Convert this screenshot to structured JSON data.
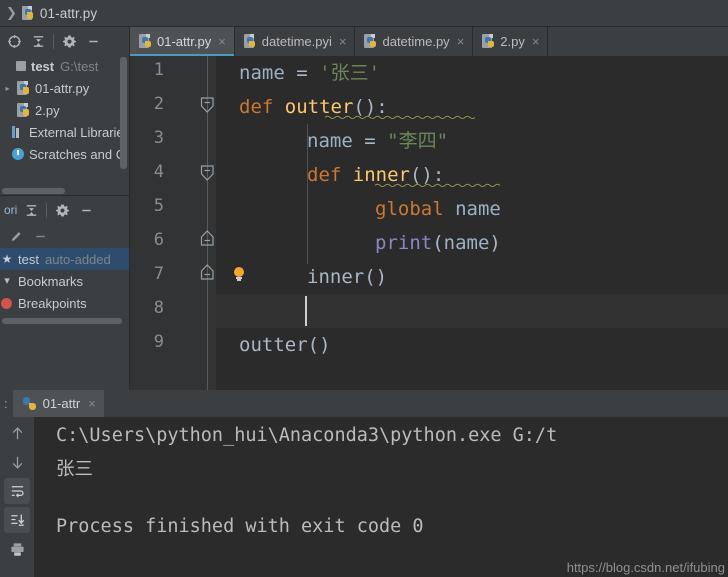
{
  "window": {
    "breadcrumb": {
      "chevron": "❯",
      "file": "01-attr.py",
      "icon": "python-file-icon"
    }
  },
  "colors": {
    "accent": "#4a9ac4",
    "panel_bg": "#3c3f41",
    "editor_bg": "#2b2b2b",
    "gutter_bg": "#313335",
    "selection": "#2d4c6e",
    "keyword": "#cc7832",
    "string": "#6a8759",
    "function": "#ffc66d",
    "builtin": "#8888c6",
    "identifier": "#9eb0c4",
    "line_number": "#8c8c8c",
    "bulb": "#f0a732"
  },
  "project_panel": {
    "toolbar": [
      {
        "name": "locate-target-icon",
        "title": "Select Opened File"
      },
      {
        "name": "collapse-all-icon",
        "title": "Collapse All"
      },
      {
        "name": "gear-icon",
        "title": "Settings"
      },
      {
        "name": "minimize-icon",
        "title": "Hide"
      }
    ],
    "tree": [
      {
        "label": "test",
        "sub": "G:\\test",
        "icon": "module-icon",
        "arrow": "",
        "bold": true,
        "selected": false
      },
      {
        "label": "01-attr.py",
        "sub": "",
        "icon": "python-file-icon",
        "arrow": "▸",
        "bold": false,
        "selected": false
      },
      {
        "label": "2.py",
        "sub": "",
        "icon": "python-file-icon",
        "arrow": "",
        "bold": false,
        "selected": false
      },
      {
        "label": "External Librarie",
        "sub": "",
        "icon": "library-icon",
        "arrow": "",
        "bold": false,
        "selected": false
      },
      {
        "label": "Scratches and C",
        "sub": "",
        "icon": "scratches-icon",
        "arrow": "",
        "bold": false,
        "selected": false
      }
    ]
  },
  "favorites_panel": {
    "title": "ori",
    "toolbar": [
      {
        "name": "collapse-all-icon",
        "title": "Collapse All"
      },
      {
        "name": "gear-icon",
        "title": "Settings"
      },
      {
        "name": "minimize-icon",
        "title": "Hide"
      }
    ],
    "subtoolbar": [
      {
        "name": "edit-pencil-icon",
        "title": "Edit"
      },
      {
        "name": "remove-icon",
        "title": "Remove"
      }
    ],
    "tree": [
      {
        "label": "test",
        "sub": "auto-added",
        "icon": "star-icon",
        "selected": true
      },
      {
        "label": "Bookmarks",
        "sub": "",
        "icon": "bookmark-icon",
        "selected": false
      },
      {
        "label": "Breakpoints",
        "sub": "",
        "icon": "breakpoint-icon",
        "selected": false
      }
    ]
  },
  "editor": {
    "tabs": [
      {
        "label": "01-attr.py",
        "active": true,
        "close": "×"
      },
      {
        "label": "datetime.pyi",
        "active": false,
        "close": "×"
      },
      {
        "label": "datetime.py",
        "active": false,
        "close": "×"
      },
      {
        "label": "2.py",
        "active": false,
        "close": "×"
      }
    ],
    "line_numbers": [
      "1",
      "2",
      "3",
      "4",
      "5",
      "6",
      "7",
      "8",
      "9"
    ],
    "current_line": 8,
    "fold_markers": [
      {
        "line": 2,
        "direction": "expanded-down"
      },
      {
        "line": 4,
        "direction": "expanded-down"
      },
      {
        "line": 6,
        "direction": "expanded-up"
      },
      {
        "line": 7,
        "direction": "expanded-up"
      }
    ],
    "inspection_bulb": {
      "line": 7,
      "name": "intention-bulb-icon"
    },
    "code": [
      {
        "n": 1,
        "indent": 0,
        "tokens": [
          {
            "t": "name",
            "c": "var"
          },
          {
            "t": " ",
            "c": "plain"
          },
          {
            "t": "=",
            "c": "op"
          },
          {
            "t": " ",
            "c": "plain"
          },
          {
            "t": "'张三'",
            "c": "str"
          }
        ]
      },
      {
        "n": 2,
        "indent": 0,
        "tokens": [
          {
            "t": "def",
            "c": "kw"
          },
          {
            "t": " ",
            "c": "plain"
          },
          {
            "t": "outter",
            "c": "fn"
          },
          {
            "t": "():",
            "c": "plain"
          }
        ]
      },
      {
        "n": 3,
        "indent": 1,
        "tokens": [
          {
            "t": "name",
            "c": "var"
          },
          {
            "t": " ",
            "c": "plain"
          },
          {
            "t": "=",
            "c": "op"
          },
          {
            "t": " ",
            "c": "plain"
          },
          {
            "t": "\"李四\"",
            "c": "str"
          }
        ]
      },
      {
        "n": 4,
        "indent": 1,
        "tokens": [
          {
            "t": "def",
            "c": "kw"
          },
          {
            "t": " ",
            "c": "plain"
          },
          {
            "t": "inner",
            "c": "fn"
          },
          {
            "t": "():",
            "c": "plain"
          }
        ]
      },
      {
        "n": 5,
        "indent": 2,
        "tokens": [
          {
            "t": "global",
            "c": "kw"
          },
          {
            "t": " ",
            "c": "plain"
          },
          {
            "t": "name",
            "c": "var"
          }
        ]
      },
      {
        "n": 6,
        "indent": 2,
        "tokens": [
          {
            "t": "print",
            "c": "builtin"
          },
          {
            "t": "(",
            "c": "plain"
          },
          {
            "t": "name",
            "c": "var"
          },
          {
            "t": ")",
            "c": "plain"
          }
        ]
      },
      {
        "n": 7,
        "indent": 1,
        "tokens": [
          {
            "t": "inner()",
            "c": "plain"
          }
        ]
      },
      {
        "n": 8,
        "indent": 0,
        "tokens": []
      },
      {
        "n": 9,
        "indent": 0,
        "tokens": [
          {
            "t": "outter()",
            "c": "plain"
          }
        ]
      }
    ]
  },
  "run_panel": {
    "label_prefix": ":",
    "tab": {
      "label": "01-attr",
      "close": "×",
      "icon": "python-icon"
    },
    "toolbar": [
      {
        "name": "up-arrow-icon",
        "title": "Previous Occurrence"
      },
      {
        "name": "down-arrow-icon",
        "title": "Next Occurrence"
      },
      {
        "name": "soft-wrap-icon",
        "title": "Soft-Wrap"
      },
      {
        "name": "scroll-to-end-icon",
        "title": "Scroll to End"
      },
      {
        "name": "print-icon",
        "title": "Print"
      }
    ],
    "output": [
      "C:\\Users\\python_hui\\Anaconda3\\python.exe G:/t",
      "张三",
      "",
      "Process finished with exit code 0"
    ],
    "output_lines": {
      "l1": "C:\\Users\\python_hui\\Anaconda3\\python.exe G:/t",
      "l2": "张三",
      "l3": "Process finished with exit code 0"
    },
    "watermark": "https://blog.csdn.net/ifubing"
  }
}
